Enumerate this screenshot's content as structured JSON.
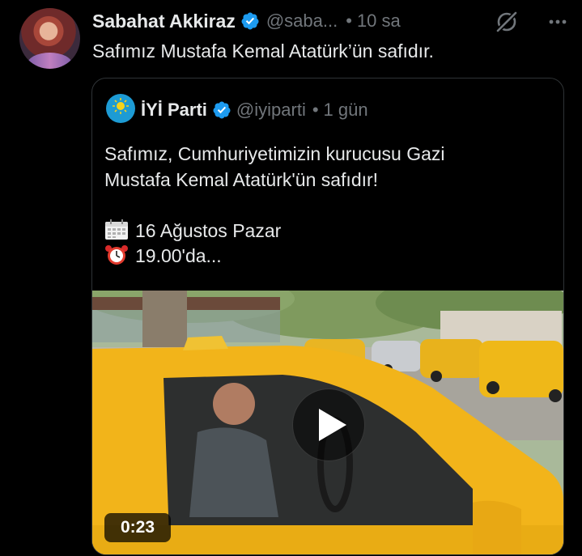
{
  "tweet": {
    "author": {
      "display_name": "Sabahat Akkiraz",
      "handle": "@saba...",
      "verified": true,
      "verified_icon": "verified-badge-icon"
    },
    "time_separator": "•",
    "time": "10 sa",
    "text": "Safımız Mustafa Kemal Atatürk’ün safıdır.",
    "actions": {
      "grok_icon": "grok-icon",
      "more_icon": "more-icon"
    }
  },
  "quoted_tweet": {
    "author": {
      "display_name": "İYİ Parti",
      "handle": "@iyiparti",
      "verified": true,
      "avatar_label": "İYİPARTİ"
    },
    "time_separator": "•",
    "time": "1 gün",
    "text_lines": [
      "Safımız, Cumhuriyetimizin kurucusu Gazi",
      "Mustafa Kemal Atatürk'ün safıdır!",
      "",
      "16 Ağustos Pazar",
      "19.00'da..."
    ],
    "emojis": [
      "calendar-icon",
      "alarm-clock-icon"
    ],
    "video": {
      "duration": "0:23",
      "play_icon": "play-icon"
    }
  },
  "colors": {
    "background": "#000000",
    "text_primary": "#e7e9ea",
    "text_secondary": "#71767b",
    "border": "#2f3336",
    "verified_blue": "#1d9bf0",
    "taxi_yellow": "#f2b41a"
  }
}
